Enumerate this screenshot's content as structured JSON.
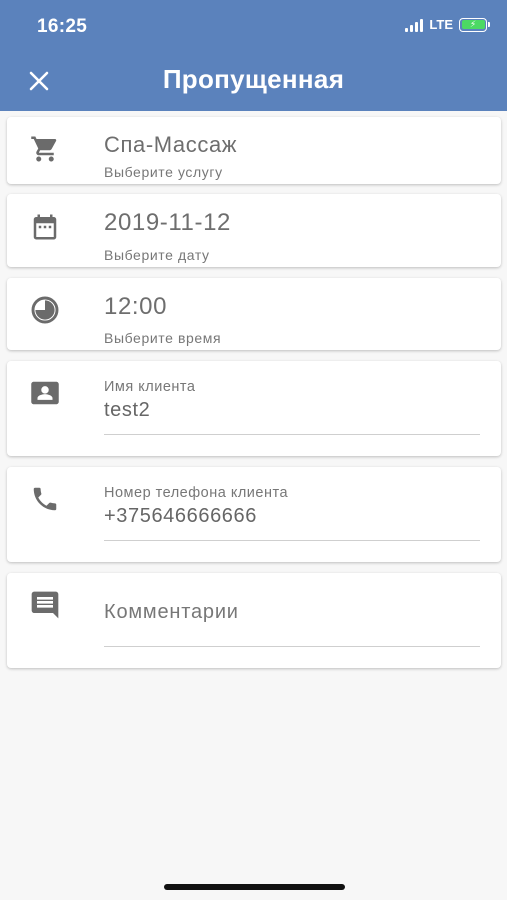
{
  "status_bar": {
    "time": "16:25",
    "network": "LTE",
    "battery_icon": "battery-charging-icon",
    "battery_level": 1.0
  },
  "header": {
    "title": "Пропущенная",
    "close_icon": "close-icon",
    "background": "#5b82bc"
  },
  "form": {
    "service": {
      "icon": "cart-icon",
      "value": "Спа-Массаж",
      "hint": "Выберите услугу"
    },
    "date": {
      "icon": "calendar-icon",
      "value": "2019-11-12",
      "hint": "Выберите дату"
    },
    "time": {
      "icon": "clock-icon",
      "value": "12:00",
      "hint": "Выберите время"
    },
    "client_name": {
      "icon": "contact-card-icon",
      "label": "Имя клиента",
      "value": "test2"
    },
    "client_phone": {
      "icon": "phone-icon",
      "label": "Номер телефона клиента",
      "value": "+375646666666"
    },
    "comment": {
      "icon": "comment-icon",
      "placeholder": "Комментарии"
    }
  }
}
